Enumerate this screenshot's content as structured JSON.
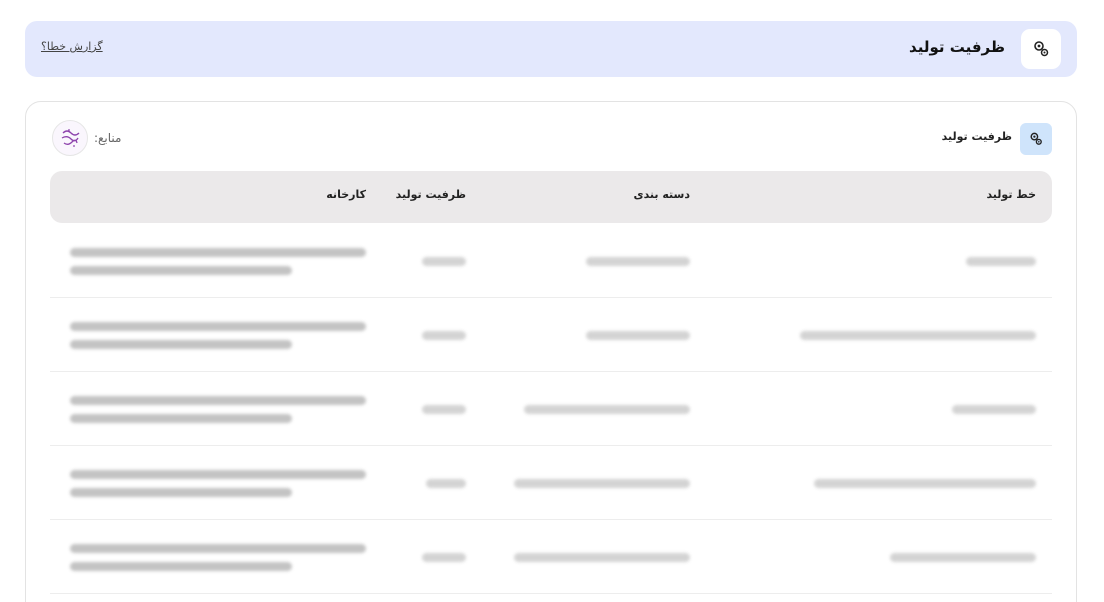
{
  "header": {
    "title": "ظرفیت تولید",
    "report_link": "گزارش خطا؟",
    "icon": "gears-icon"
  },
  "card": {
    "title": "ظرفیت تولید",
    "icon": "gears-icon",
    "sources_label": "منابع:",
    "source_logo": "calligraphy-logo-icon"
  },
  "table": {
    "columns": [
      "خط تولید",
      "دسته بندی",
      "ظرفیت تولید",
      "کارخانه"
    ]
  },
  "colors": {
    "header_bg": "#e3e8fd",
    "icon_box_bg": "#cfe4fb",
    "table_head_bg": "#ebe9ea",
    "logo_purple": "#8e44ad"
  }
}
